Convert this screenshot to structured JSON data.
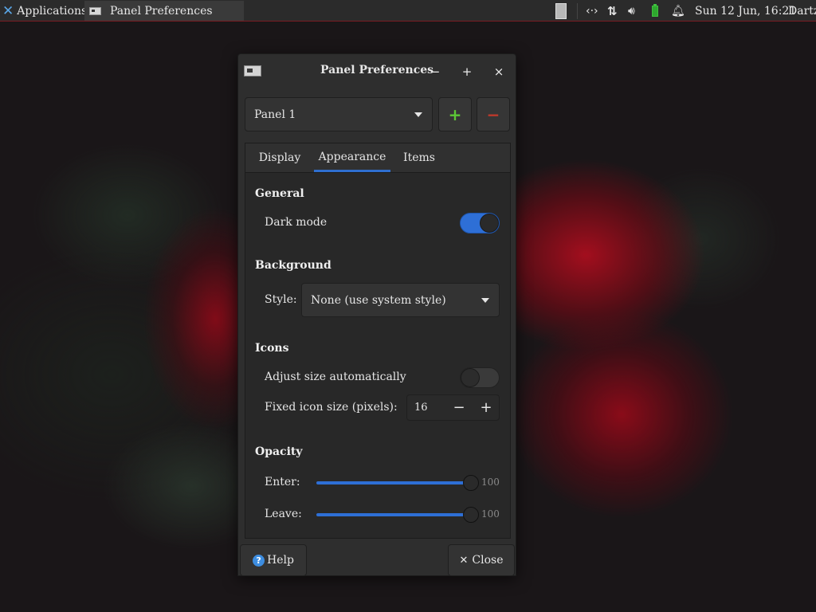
{
  "top_panel": {
    "applications_label": "Applications",
    "task_label": "Panel Preferences",
    "clock": "Sun 12 Jun, 16:21",
    "user": "Dartz",
    "icons": [
      "applications-menu-icon",
      "window-icon",
      "workspace-switcher-icon",
      "network-arrows-icon",
      "network-updown-icon",
      "volume-icon",
      "battery-icon",
      "notification-bell-icon"
    ],
    "colors": {
      "panel_bg": "#2b2b2b",
      "battery": "#2ea82e",
      "xfce_logo": "#5aa6e6"
    }
  },
  "dialog": {
    "title": "Panel Preferences",
    "titlebar_buttons": {
      "minimize": "−",
      "maximize": "+",
      "close": "×"
    },
    "panel_selector": {
      "value": "Panel 1"
    },
    "add_button": "+",
    "remove_button": "−",
    "tabs": [
      {
        "label": "Display",
        "active": false
      },
      {
        "label": "Appearance",
        "active": true
      },
      {
        "label": "Items",
        "active": false
      }
    ],
    "general": {
      "heading": "General",
      "dark_mode_label": "Dark mode",
      "dark_mode": true
    },
    "background": {
      "heading": "Background",
      "style_label": "Style:",
      "style_value": "None (use system style)"
    },
    "icons": {
      "heading": "Icons",
      "adjust_label": "Adjust size automatically",
      "adjust_enabled": false,
      "fixed_label": "Fixed icon size (pixels):",
      "fixed_value": "16",
      "minus": "−",
      "plus": "+"
    },
    "opacity": {
      "heading": "Opacity",
      "enter_label": "Enter:",
      "enter_value": "100",
      "enter_level": 1.0,
      "leave_label": "Leave:",
      "leave_value": "100",
      "leave_level": 1.0
    },
    "footer": {
      "help_label": "Help",
      "help_glyph": "?",
      "close_label": "Close"
    },
    "colors": {
      "accent": "#2e6fd6",
      "add": "#5cc936",
      "remove": "#c0392b"
    }
  }
}
